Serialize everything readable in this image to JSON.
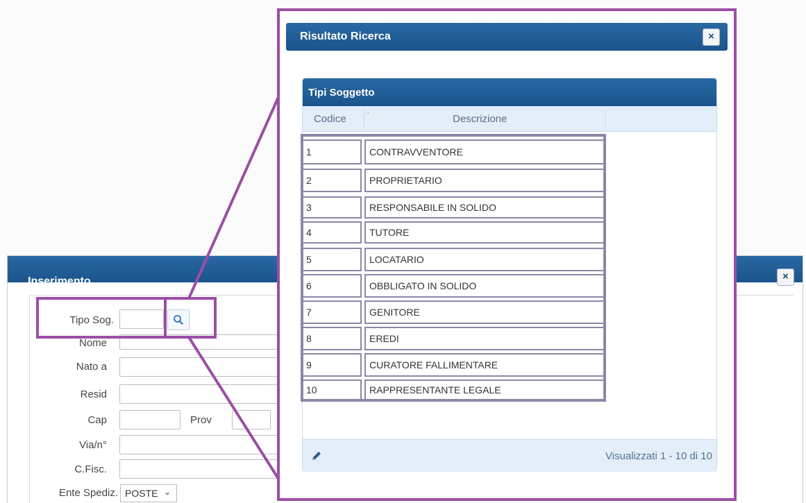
{
  "insert_window": {
    "title": "Inserimento",
    "close_glyph": "×",
    "fields": {
      "tipo_sog": "Tipo Sog.",
      "nome": "Nome",
      "nato_a": "Nato a",
      "resid": "Resid",
      "cap": "Cap",
      "prov": "Prov",
      "via": "Via/n°",
      "cfisc": "C.Fisc.",
      "ente_spediz": "Ente Spediz."
    },
    "ente_spediz_value": "POSTE"
  },
  "result_popup": {
    "title": "Risultato Ricerca",
    "close_glyph": "×",
    "grid": {
      "caption": "Tipi Soggetto",
      "columns": {
        "codice": "Codice",
        "sort_marker": "ˆ",
        "descrizione": "Descrizione"
      },
      "rows": [
        {
          "code": "1",
          "desc": "CONTRAVVENTORE"
        },
        {
          "code": "2",
          "desc": "PROPRIETARIO"
        },
        {
          "code": "3",
          "desc": "RESPONSABILE IN SOLIDO"
        },
        {
          "code": "4",
          "desc": "TUTORE"
        },
        {
          "code": "5",
          "desc": "LOCATARIO"
        },
        {
          "code": "6",
          "desc": "OBBLIGATO IN SOLIDO"
        },
        {
          "code": "7",
          "desc": "GENITORE"
        },
        {
          "code": "8",
          "desc": "EREDI"
        },
        {
          "code": "9",
          "desc": "CURATORE FALLIMENTARE"
        },
        {
          "code": "10",
          "desc": "RAPPRESENTANTE LEGALE"
        }
      ],
      "footer_status": "Visualizzati 1 - 10 di 10"
    }
  },
  "colors": {
    "header_blue": "#1f5b96",
    "highlight_purple": "#9c4ea6",
    "row_border": "#8e86a6",
    "grid_head_bg": "#e3eef9"
  },
  "icons": {
    "search": "search-icon",
    "edit": "pencil-icon",
    "close": "close-icon",
    "dropdown": "chevron-down-icon"
  }
}
